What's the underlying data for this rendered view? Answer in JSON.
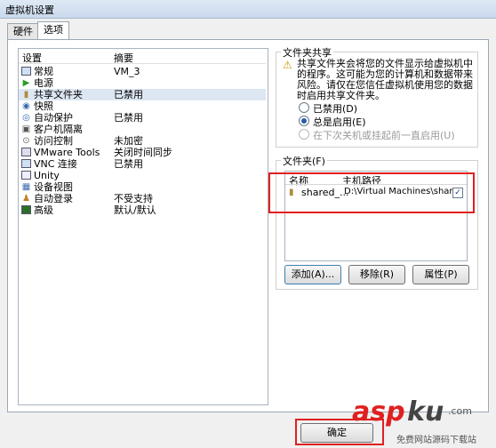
{
  "window": {
    "title": "虚拟机设置"
  },
  "tabs": [
    {
      "label": "硬件"
    },
    {
      "label": "选项"
    }
  ],
  "settings_list": {
    "headers": {
      "name": "设置",
      "summary": "摘要"
    },
    "rows": [
      {
        "name": "常规",
        "value": "VM_3"
      },
      {
        "name": "电源",
        "value": ""
      },
      {
        "name": "共享文件夹",
        "value": "已禁用"
      },
      {
        "name": "快照",
        "value": ""
      },
      {
        "name": "自动保护",
        "value": "已禁用"
      },
      {
        "name": "客户机隔离",
        "value": ""
      },
      {
        "name": "访问控制",
        "value": "未加密"
      },
      {
        "name": "VMware Tools",
        "value": "关闭时间同步"
      },
      {
        "name": "VNC 连接",
        "value": "已禁用"
      },
      {
        "name": "Unity",
        "value": ""
      },
      {
        "name": "设备视图",
        "value": ""
      },
      {
        "name": "自动登录",
        "value": "不受支持"
      },
      {
        "name": "高级",
        "value": "默认/默认"
      }
    ],
    "icons": [
      "monitor-icon",
      "power-play-icon",
      "shared-folder-icon",
      "snapshot-icon",
      "autoprotect-icon",
      "guest-isolation-icon",
      "access-control-icon",
      "vmware-tools-icon",
      "vnc-icon",
      "unity-icon",
      "device-view-icon",
      "autologin-icon",
      "advanced-icon"
    ]
  },
  "folder_sharing": {
    "title": "文件夹共享",
    "warning": [
      "共享文件夹会将您的文件显示给虚拟机中",
      "的程序。这可能为您的计算机和数据带来",
      "风险。请仅在您信任虚拟机使用您的数据",
      "时启用共享文件夹。"
    ],
    "options": [
      {
        "label": "已禁用(D)",
        "selected": false,
        "enabled": true
      },
      {
        "label": "总是启用(E)",
        "selected": true,
        "enabled": true
      },
      {
        "label": "在下次关机或挂起前一直启用(U)",
        "selected": false,
        "enabled": false
      }
    ]
  },
  "folders": {
    "title": "文件夹(F)",
    "headers": {
      "name": "名称",
      "host_path": "主机路径"
    },
    "rows": [
      {
        "name": "shared_...",
        "path": "D:\\Virtual Machines\\shar...",
        "checked": true
      }
    ],
    "buttons": {
      "add": "添加(A)...",
      "remove": "移除(R)",
      "properties": "属性(P)"
    }
  },
  "footer": {
    "ok": "确定"
  },
  "watermark": {
    "main": "asp",
    "sub": "ku",
    "tld": ".com",
    "caption": "免费网站源码下载站"
  },
  "colors": {
    "highlight_red": "#e02020",
    "selected_row": "#dde7f3",
    "watermark_red": "#e02020"
  }
}
